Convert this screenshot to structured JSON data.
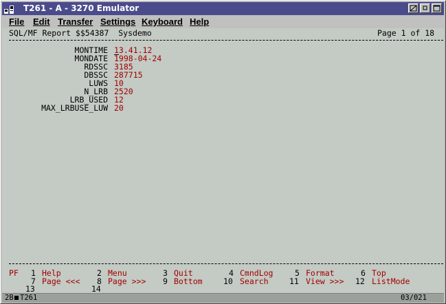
{
  "window": {
    "title": "T261 - A - 3270 Emulator"
  },
  "menu": [
    "File",
    "Edit",
    "Transfer",
    "Settings",
    "Keyboard",
    "Help"
  ],
  "header": {
    "left": "SQL/MF Report $$54387  Sysdemo",
    "right": "Page 1 of 18"
  },
  "fields": [
    {
      "label": "MONTIME",
      "value": "13.41.12"
    },
    {
      "label": "MONDATE",
      "value": "1998-04-24"
    },
    {
      "label": "RDSSC",
      "value": "3185"
    },
    {
      "label": "DBSSC",
      "value": "287715"
    },
    {
      "label": "LUWS",
      "value": "10"
    },
    {
      "label": "N_LRB",
      "value": "2520"
    },
    {
      "label": "LRB_USED",
      "value": "12"
    },
    {
      "label": "MAX_LRBUSE_LUW",
      "value": "20"
    }
  ],
  "pf": {
    "label": "PF",
    "row1": [
      {
        "num": "1",
        "name": "Help"
      },
      {
        "num": "2",
        "name": "Menu"
      },
      {
        "num": "3",
        "name": "Quit"
      },
      {
        "num": "4",
        "name": "CmndLog"
      },
      {
        "num": "5",
        "name": "Format"
      },
      {
        "num": "6",
        "name": "Top"
      }
    ],
    "row2": [
      {
        "num": "7",
        "name": "Page <<<"
      },
      {
        "num": "8",
        "name": "Page >>>"
      },
      {
        "num": "9",
        "name": "Bottom"
      },
      {
        "num": "10",
        "name": "Search"
      },
      {
        "num": "11",
        "name": "View >>>"
      },
      {
        "num": "12",
        "name": "ListMode"
      }
    ],
    "row3": [
      "13",
      "14"
    ]
  },
  "status": {
    "left": "2B",
    "session": "T261",
    "position": "03/021"
  },
  "colors": {
    "title_bar": "#4b4b8c",
    "terminal_bg": "#c4cac4",
    "value_text": "#a00000"
  }
}
